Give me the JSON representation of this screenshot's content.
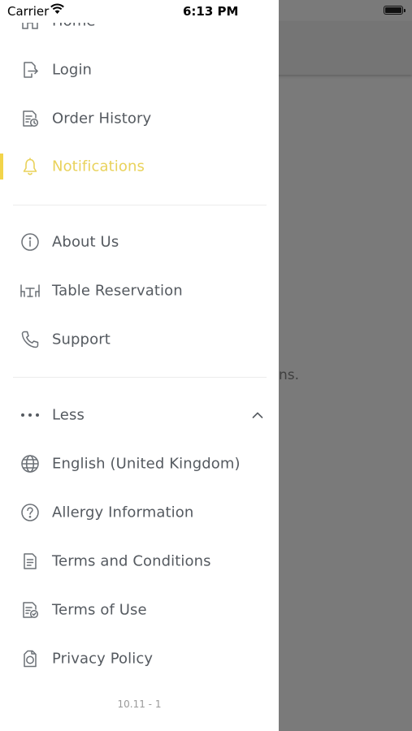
{
  "status_bar": {
    "carrier": "Carrier",
    "time": "6:13 PM"
  },
  "background": {
    "partial_text": "ns."
  },
  "menu": {
    "primary": [
      {
        "label": "Home",
        "icon": "home-icon"
      },
      {
        "label": "Login",
        "icon": "login-icon"
      },
      {
        "label": "Order History",
        "icon": "order-history-icon"
      },
      {
        "label": "Notifications",
        "icon": "bell-icon",
        "active": true
      }
    ],
    "secondary": [
      {
        "label": "About Us",
        "icon": "info-icon"
      },
      {
        "label": "Table Reservation",
        "icon": "table-reservation-icon"
      },
      {
        "label": "Support",
        "icon": "phone-icon"
      }
    ],
    "more": {
      "label": "Less",
      "icon": "more-dots-icon",
      "expanded": true
    },
    "extra": [
      {
        "label": "English (United Kingdom)",
        "icon": "globe-icon"
      },
      {
        "label": "Allergy Information",
        "icon": "question-icon"
      },
      {
        "label": "Terms and Conditions",
        "icon": "document-icon"
      },
      {
        "label": "Terms of Use",
        "icon": "document-check-icon"
      },
      {
        "label": "Privacy Policy",
        "icon": "privacy-icon"
      }
    ]
  },
  "version": "10.11 - 1",
  "colors": {
    "accent": "#f2d44a",
    "active_text": "#e9d25b",
    "text": "#555a60",
    "overlay": "#7a7a7a"
  }
}
